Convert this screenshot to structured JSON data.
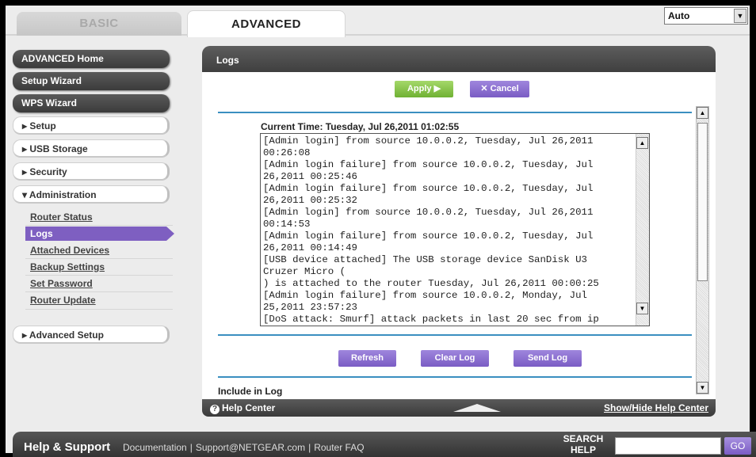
{
  "tabs": {
    "basic": "BASIC",
    "advanced": "ADVANCED"
  },
  "language": {
    "selected": "Auto"
  },
  "sidebar": {
    "advanced_home": "ADVANCED Home",
    "setup_wizard": "Setup Wizard",
    "wps_wizard": "WPS Wizard",
    "setup": "▸ Setup",
    "usb_storage": "▸ USB Storage",
    "security": "▸ Security",
    "administration": "▾ Administration",
    "admin_items": [
      "Router Status",
      "Logs",
      "Attached Devices",
      "Backup Settings",
      "Set Password",
      "Router Update"
    ],
    "advanced_setup": "▸ Advanced Setup"
  },
  "panel": {
    "title": "Logs",
    "apply": "Apply ▶",
    "cancel": "✕ Cancel",
    "current_time": "Current Time: Tuesday, Jul 26,2011 01:02:55",
    "log_lines": [
      "[Admin login] from source 10.0.0.2, Tuesday, Jul 26,2011",
      "00:26:08",
      "[Admin login failure] from source 10.0.0.2, Tuesday, Jul",
      "26,2011 00:25:46",
      "[Admin login failure] from source 10.0.0.2, Tuesday, Jul",
      "26,2011 00:25:32",
      "[Admin login] from source 10.0.0.2, Tuesday, Jul 26,2011",
      "00:14:53",
      "[Admin login failure] from source 10.0.0.2, Tuesday, Jul",
      "26,2011 00:14:49",
      "[USB device attached] The USB storage device SanDisk U3",
      "Cruzer Micro (",
      ") is attached to the router Tuesday, Jul 26,2011 00:00:25",
      "[Admin login failure] from source 10.0.0.2, Monday, Jul",
      "25,2011 23:57:23",
      "[DoS attack: Smurf] attack packets in last 20 sec from ip"
    ],
    "refresh": "Refresh",
    "clear_log": "Clear Log",
    "send_log": "Send Log",
    "include_in_log": "Include in Log",
    "help_center": "Help Center",
    "show_hide": "Show/Hide Help Center"
  },
  "footer": {
    "help_support": "Help & Support",
    "documentation": "Documentation",
    "support_email": "Support@NETGEAR.com",
    "router_faq": "Router FAQ",
    "search_help": "SEARCH HELP",
    "go": "GO"
  }
}
